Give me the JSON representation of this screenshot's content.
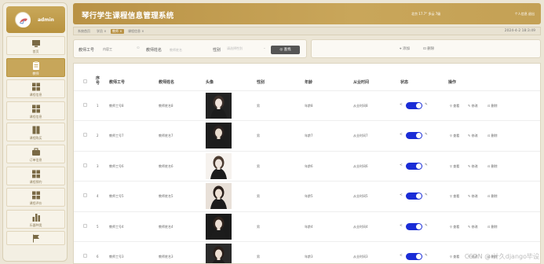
{
  "sidebar": {
    "user_name": "admin",
    "items": [
      {
        "label": "首页",
        "icon": "monitor-icon"
      },
      {
        "label": "教师",
        "icon": "clipboard-icon"
      },
      {
        "label": "课程信息",
        "icon": "grid-icon"
      },
      {
        "label": "课程信息",
        "icon": "grid-icon"
      },
      {
        "label": "课程购买",
        "icon": "book-icon"
      },
      {
        "label": "订单信息",
        "icon": "briefcase-icon"
      },
      {
        "label": "课程预约",
        "icon": "grid-icon"
      },
      {
        "label": "课程评价",
        "icon": "grid-icon"
      },
      {
        "label": "乐器种类",
        "icon": "bar-chart-icon"
      },
      {
        "label": "",
        "icon": "flag-icon"
      }
    ]
  },
  "header": {
    "title": "琴行学生课程信息管理系统",
    "meta": "北京  17.7°  多云  7级",
    "user": "个人信息  退出"
  },
  "breadcrumb": {
    "items": [
      "系统首页",
      "学员 ×",
      "教师 ×",
      "课程信息 ×"
    ],
    "time": "2024-4-2 18:3:49"
  },
  "search": {
    "teacher_id_label": "教师工号",
    "teacher_id_value": "内容工",
    "teacher_name_label": "教师姓名",
    "teacher_name_placeholder": "教师姓名",
    "gender_label": "性别",
    "gender_placeholder": "请选择性别",
    "search_button": "查找"
  },
  "actions": {
    "add": "添加",
    "delete": "删除"
  },
  "table": {
    "headers": [
      "序号",
      "教师工号",
      "教师姓名",
      "头像",
      "性别",
      "年龄",
      "从业时间",
      "状态",
      "操作"
    ],
    "rows": [
      {
        "no": "1",
        "id": "教师工号8",
        "name": "教师姓名8",
        "gender": "男",
        "age": "年龄8",
        "years": "从业时间8"
      },
      {
        "no": "2",
        "id": "教师工号7",
        "name": "教师姓名7",
        "gender": "男",
        "age": "年龄7",
        "years": "从业时间7"
      },
      {
        "no": "3",
        "id": "教师工号6",
        "name": "教师姓名6",
        "gender": "男",
        "age": "年龄6",
        "years": "从业时间6"
      },
      {
        "no": "4",
        "id": "教师工号5",
        "name": "教师姓名5",
        "gender": "男",
        "age": "年龄5",
        "years": "从业时间5"
      },
      {
        "no": "5",
        "id": "教师工号4",
        "name": "教师姓名4",
        "gender": "男",
        "age": "年龄4",
        "years": "从业时间4"
      },
      {
        "no": "6",
        "id": "教师工号3",
        "name": "教师姓名3",
        "gender": "男",
        "age": "年龄3",
        "years": "从业时间3"
      }
    ],
    "ops": {
      "view": "查看",
      "edit": "修改",
      "delete": "删除"
    }
  },
  "watermark": "CSDN @ 计久django毕设",
  "colors": {
    "accent": "#b99245",
    "toggle": "#1a2cd6"
  }
}
